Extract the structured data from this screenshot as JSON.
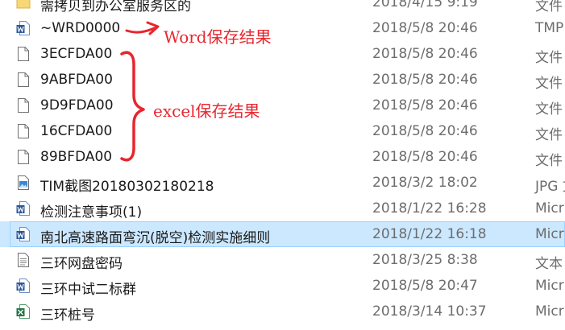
{
  "files": [
    {
      "name": "需拷贝到办公室服务区的",
      "date": "2018/4/15 9:19",
      "type": "文件",
      "icon": "folder-icon"
    },
    {
      "name": "~WRD0000",
      "date": "2018/5/8 20:46",
      "type": "TMP",
      "icon": "word-doc-icon"
    },
    {
      "name": "3ECFDA00",
      "date": "2018/5/8 20:46",
      "type": "文件",
      "icon": "blank-file-icon"
    },
    {
      "name": "9ABFDA00",
      "date": "2018/5/8 20:46",
      "type": "文件",
      "icon": "blank-file-icon"
    },
    {
      "name": "9D9FDA00",
      "date": "2018/5/8 20:46",
      "type": "文件",
      "icon": "blank-file-icon"
    },
    {
      "name": "16CFDA00",
      "date": "2018/5/8 20:46",
      "type": "文件",
      "icon": "blank-file-icon"
    },
    {
      "name": "89BFDA00",
      "date": "2018/5/8 20:46",
      "type": "文件",
      "icon": "blank-file-icon"
    },
    {
      "name": "TIM截图20180302180218",
      "date": "2018/3/2 18:02",
      "type": "JPG 文",
      "icon": "image-file-icon"
    },
    {
      "name": "检测注意事项(1)",
      "date": "2018/1/22 16:28",
      "type": "Micr",
      "icon": "word-doc-icon"
    },
    {
      "name": "南北高速路面弯沉(脱空)检测实施细则",
      "date": "2018/1/22 16:18",
      "type": "Micr",
      "icon": "word-doc-icon"
    },
    {
      "name": "三环网盘密码",
      "date": "2018/3/25 8:38",
      "type": "文本",
      "icon": "text-file-icon"
    },
    {
      "name": "三环中试二标群",
      "date": "2018/5/8 20:47",
      "type": "Micr",
      "icon": "word-doc-icon"
    },
    {
      "name": "三环桩号",
      "date": "2018/3/14 10:37",
      "type": "Micr",
      "icon": "excel-file-icon"
    }
  ],
  "selected_index": 9,
  "annotations": {
    "word": "Word保存结果",
    "excel": "excel保存结果",
    "color": "#e8262e"
  }
}
